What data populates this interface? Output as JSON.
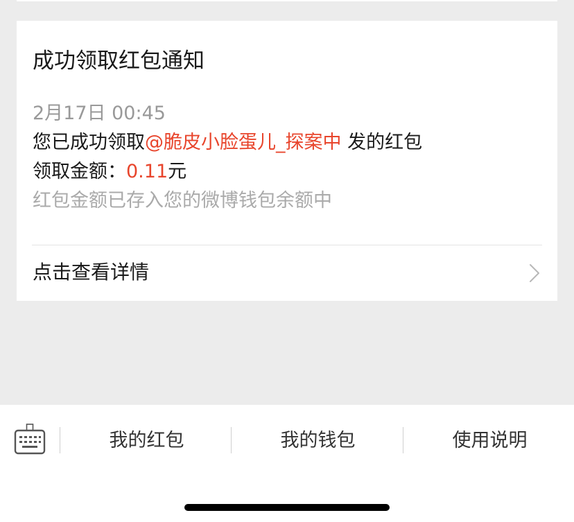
{
  "notification": {
    "title": "成功领取红包通知",
    "time": "2月17日 00:45",
    "message_prefix": "您已成功领取",
    "sender": "@脆皮小脸蛋儿_探案中",
    "message_suffix": " 发的红包",
    "amount_label": "领取金额：",
    "amount_value": "0.11",
    "amount_unit": "元",
    "note": "红包金额已存入您的微博钱包余额中",
    "detail_link": "点击查看详情"
  },
  "bottom_menu": {
    "items": [
      {
        "label": "我的红包"
      },
      {
        "label": "我的钱包"
      },
      {
        "label": "使用说明"
      }
    ]
  },
  "colors": {
    "accent": "#e8452c",
    "background": "#ececec",
    "card": "#ffffff",
    "muted_text": "#aaaaaa",
    "primary_text": "#1a1a1a"
  },
  "icons": {
    "keyboard": "keyboard-icon",
    "detail_arrow": "chevron-right-icon"
  }
}
